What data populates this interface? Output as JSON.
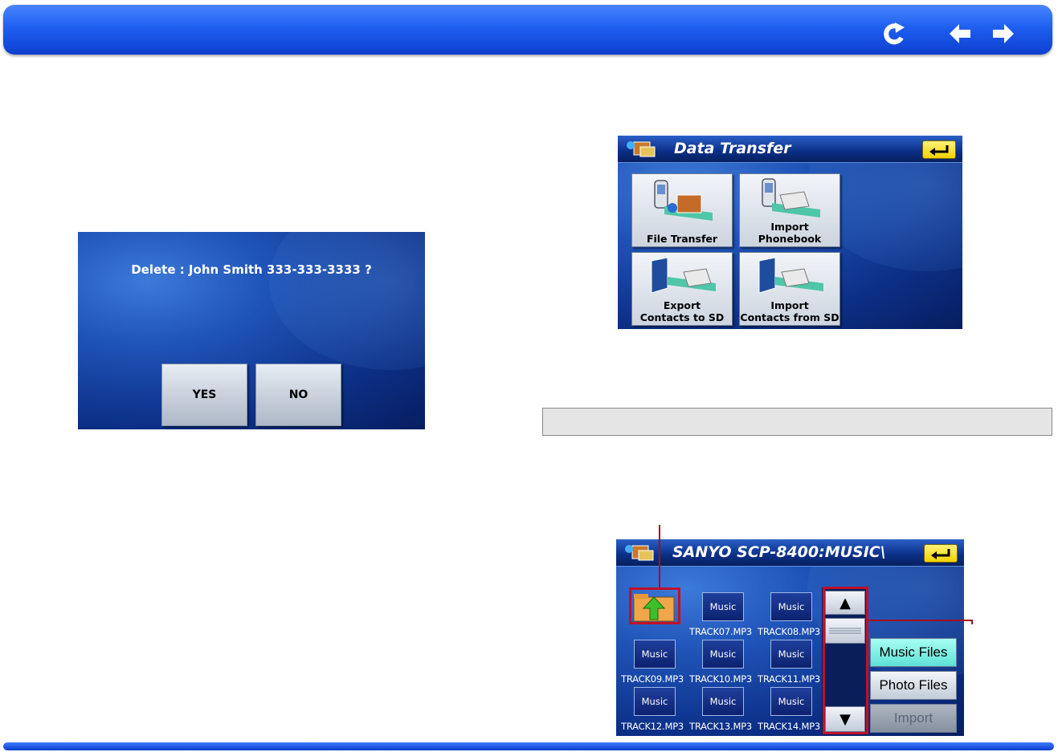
{
  "header": {
    "icons": [
      "refresh-icon",
      "arrow-left-icon",
      "arrow-right-icon"
    ],
    "color": "#1f5ff0"
  },
  "delete_dialog": {
    "message": "Delete : John Smith 333-333-3333 ?",
    "yes_label": "YES",
    "no_label": "NO"
  },
  "data_transfer": {
    "title": "Data Transfer",
    "tiles": [
      {
        "label": "File Transfer"
      },
      {
        "label": "Import\nPhonebook"
      },
      {
        "label": "Export\nContacts to SD"
      },
      {
        "label": "Import\nContacts from SD"
      }
    ]
  },
  "file_browser": {
    "title": "SANYO SCP-8400:MUSIC\\",
    "file_icon_label": "Music",
    "files": [
      "TRACK07.MP3",
      "TRACK08.MP3",
      "TRACK09.MP3",
      "TRACK10.MP3",
      "TRACK11.MP3",
      "TRACK12.MP3",
      "TRACK13.MP3",
      "TRACK14.MP3"
    ],
    "scroll_up": "▲",
    "scroll_down": "▼",
    "music_files_label": "Music Files",
    "photo_files_label": "Photo Files",
    "import_label": "Import"
  },
  "colors": {
    "highlight": "#c0102a",
    "music_files_active": "#7ef0e6"
  }
}
